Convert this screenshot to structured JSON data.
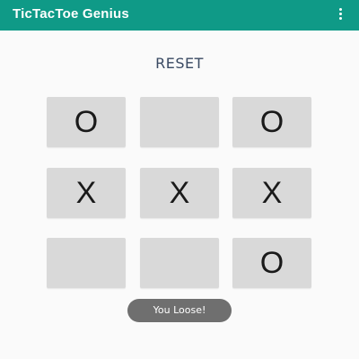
{
  "app_bar": {
    "title": "TicTacToe Genius",
    "overflow_icon": "more-vert-icon",
    "background_color": "#0f9a87"
  },
  "reset_button": {
    "label": "RESET"
  },
  "board": {
    "cells": [
      [
        "O",
        "",
        "O"
      ],
      [
        "X",
        "X",
        "X"
      ],
      [
        "",
        "",
        "O"
      ]
    ]
  },
  "toast": {
    "message": "You Loose!"
  }
}
